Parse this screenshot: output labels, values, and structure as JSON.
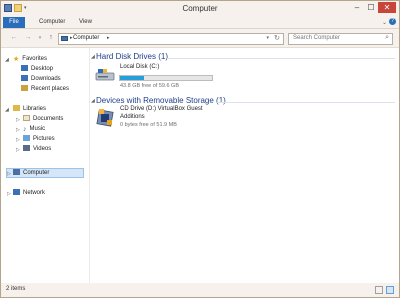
{
  "window": {
    "title": "Computer"
  },
  "ribbon": {
    "tabs": [
      "File",
      "Computer",
      "View"
    ]
  },
  "address": {
    "crumb": "Computer",
    "search_placeholder": "Search Computer"
  },
  "nav": {
    "favorites": "Favorites",
    "desktop": "Desktop",
    "downloads": "Downloads",
    "recent": "Recent places",
    "libraries": "Libraries",
    "documents": "Documents",
    "music": "Music",
    "pictures": "Pictures",
    "videos": "Videos",
    "computer": "Computer",
    "network": "Network"
  },
  "groups": {
    "hard_disk": "Hard Disk Drives (1)",
    "removable": "Devices with Removable Storage (1)"
  },
  "drives": {
    "local": {
      "name": "Local Disk (C:)",
      "free_text": "43.8 GB free of 59.6 GB",
      "used_fraction": 0.265
    },
    "cd": {
      "name_line1": "CD Drive (D:) VirtualBox Guest",
      "name_line2": "Additions",
      "free_text": "0 bytes free of 51.9 MB"
    }
  },
  "status": {
    "items": "2 items"
  },
  "colors": {
    "accent": "#2a6dbb",
    "heading": "#1e3e8a",
    "progress": "#26a0da",
    "close": "#c7453a"
  }
}
